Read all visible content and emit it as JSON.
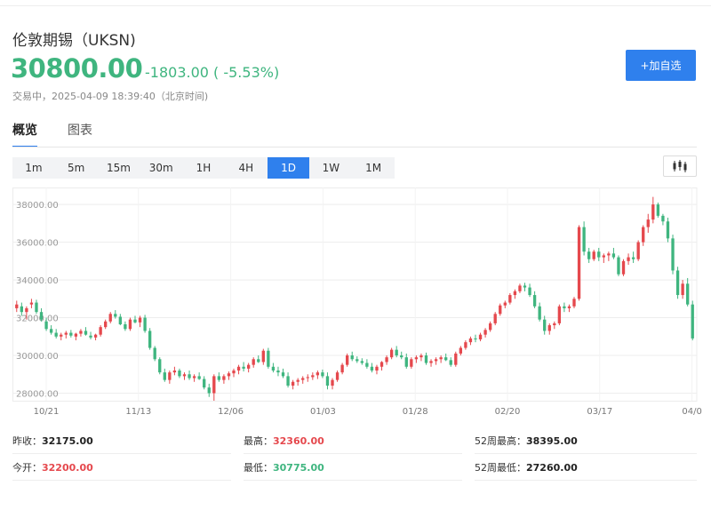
{
  "header": {
    "title": "伦敦期锡（UKSN)",
    "price": "30800.00",
    "change": "-1803.00 ( -5.53%)",
    "status": "交易中，2025-04-09 18:39:40（北京时间)",
    "add_button": "+加自选"
  },
  "tabs": [
    {
      "label": "概览",
      "active": true
    },
    {
      "label": "图表",
      "active": false
    }
  ],
  "periods": [
    {
      "label": "1m",
      "active": false
    },
    {
      "label": "5m",
      "active": false
    },
    {
      "label": "15m",
      "active": false
    },
    {
      "label": "30m",
      "active": false
    },
    {
      "label": "1H",
      "active": false
    },
    {
      "label": "4H",
      "active": false
    },
    {
      "label": "1D",
      "active": true
    },
    {
      "label": "1W",
      "active": false
    },
    {
      "label": "1M",
      "active": false
    }
  ],
  "chart_type_icon": "candlestick-icon",
  "colors": {
    "up": "#e5484d",
    "down": "#3fb57f",
    "accent": "#2f80ed"
  },
  "chart_data": {
    "type": "candlestick",
    "y_ticks": [
      "38000.00",
      "36000.00",
      "34000.00",
      "32000.00",
      "30000.00",
      "28000.00"
    ],
    "x_ticks": [
      "10/21",
      "11/13",
      "12/06",
      "01/03",
      "01/28",
      "02/20",
      "03/17",
      "04/0"
    ],
    "ylim": [
      27600,
      38900
    ],
    "grid": true,
    "candles": [
      [
        32500,
        32900,
        32300,
        32700
      ],
      [
        32600,
        32800,
        32100,
        32300
      ],
      [
        32300,
        32600,
        31900,
        32500
      ],
      [
        32700,
        33000,
        32500,
        32800
      ],
      [
        32800,
        32950,
        32200,
        32300
      ],
      [
        32300,
        32500,
        31800,
        31900
      ],
      [
        31800,
        32000,
        31300,
        31400
      ],
      [
        31400,
        31600,
        31100,
        31200
      ],
      [
        31200,
        31400,
        30900,
        31000
      ],
      [
        31000,
        31200,
        30800,
        31100
      ],
      [
        31100,
        31300,
        30900,
        31200
      ],
      [
        31200,
        31350,
        30950,
        31050
      ],
      [
        31000,
        31200,
        30800,
        31150
      ],
      [
        31150,
        31400,
        31000,
        31300
      ],
      [
        31300,
        31500,
        31050,
        31100
      ],
      [
        31050,
        31250,
        30850,
        30950
      ],
      [
        30950,
        31150,
        30800,
        31100
      ],
      [
        31100,
        31600,
        31000,
        31500
      ],
      [
        31500,
        31900,
        31400,
        31800
      ],
      [
        31800,
        32300,
        31700,
        32200
      ],
      [
        32200,
        32400,
        31950,
        32050
      ],
      [
        32050,
        32200,
        31600,
        31650
      ],
      [
        31650,
        31800,
        31300,
        31400
      ],
      [
        31400,
        32000,
        31300,
        31900
      ],
      [
        31900,
        32100,
        31700,
        31750
      ],
      [
        31750,
        32100,
        31500,
        32000
      ],
      [
        32000,
        32150,
        31200,
        31300
      ],
      [
        31300,
        31450,
        30300,
        30400
      ],
      [
        30400,
        30500,
        29700,
        29800
      ],
      [
        29800,
        29900,
        29000,
        29100
      ],
      [
        29100,
        29300,
        28600,
        28700
      ],
      [
        28700,
        29200,
        28500,
        29100
      ],
      [
        29100,
        29400,
        28950,
        29200
      ],
      [
        29200,
        29300,
        28800,
        28900
      ],
      [
        28900,
        29100,
        28700,
        29000
      ],
      [
        29000,
        29200,
        28700,
        28800
      ],
      [
        28800,
        29000,
        28600,
        28900
      ],
      [
        28900,
        29100,
        28700,
        28750
      ],
      [
        28750,
        28900,
        28200,
        28300
      ],
      [
        28300,
        28500,
        27800,
        28000
      ],
      [
        28000,
        29000,
        27600,
        28900
      ],
      [
        28900,
        29100,
        28600,
        28700
      ],
      [
        28700,
        29000,
        28500,
        28900
      ],
      [
        28900,
        29150,
        28700,
        29050
      ],
      [
        29050,
        29300,
        28850,
        29200
      ],
      [
        29200,
        29500,
        29000,
        29400
      ],
      [
        29400,
        29650,
        29150,
        29300
      ],
      [
        29300,
        29600,
        29100,
        29500
      ],
      [
        29500,
        29900,
        29350,
        29800
      ],
      [
        29800,
        30000,
        29600,
        29650
      ],
      [
        29650,
        30350,
        29500,
        30250
      ],
      [
        30250,
        30400,
        29300,
        29400
      ],
      [
        29400,
        29600,
        29100,
        29200
      ],
      [
        29200,
        29400,
        28900,
        29100
      ],
      [
        29100,
        29300,
        28800,
        28900
      ],
      [
        28900,
        29100,
        28300,
        28400
      ],
      [
        28400,
        28700,
        28200,
        28600
      ],
      [
        28600,
        28800,
        28400,
        28700
      ],
      [
        28700,
        28900,
        28500,
        28800
      ],
      [
        28800,
        29000,
        28600,
        28850
      ],
      [
        28850,
        29100,
        28700,
        28950
      ],
      [
        28950,
        29200,
        28750,
        29100
      ],
      [
        29100,
        29250,
        28800,
        28900
      ],
      [
        28900,
        29100,
        28200,
        28400
      ],
      [
        28400,
        28800,
        28200,
        28700
      ],
      [
        28700,
        29200,
        28600,
        29100
      ],
      [
        29100,
        29600,
        29000,
        29500
      ],
      [
        29500,
        30100,
        29400,
        30000
      ],
      [
        30000,
        30200,
        29700,
        29800
      ],
      [
        29800,
        29950,
        29600,
        29700
      ],
      [
        29700,
        29850,
        29500,
        29600
      ],
      [
        29600,
        29800,
        29300,
        29400
      ],
      [
        29400,
        29600,
        29100,
        29200
      ],
      [
        29200,
        29500,
        29000,
        29400
      ],
      [
        29400,
        29700,
        29200,
        29650
      ],
      [
        29650,
        30000,
        29500,
        29900
      ],
      [
        29900,
        30400,
        29800,
        30300
      ],
      [
        30300,
        30500,
        29900,
        30000
      ],
      [
        30000,
        30200,
        29800,
        29900
      ],
      [
        29900,
        30100,
        29300,
        29400
      ],
      [
        29400,
        29900,
        29300,
        29800
      ],
      [
        29800,
        30000,
        29600,
        29900
      ],
      [
        29900,
        30100,
        29700,
        30000
      ],
      [
        30000,
        30150,
        29500,
        29600
      ],
      [
        29600,
        29800,
        29400,
        29700
      ],
      [
        29700,
        29900,
        29500,
        29800
      ],
      [
        29800,
        30000,
        29600,
        29900
      ],
      [
        29900,
        30100,
        29700,
        29750
      ],
      [
        29750,
        29900,
        29400,
        29500
      ],
      [
        29500,
        30200,
        29400,
        30100
      ],
      [
        30100,
        30500,
        30000,
        30400
      ],
      [
        30400,
        30800,
        30300,
        30700
      ],
      [
        30700,
        31000,
        30550,
        30900
      ],
      [
        30900,
        31100,
        30700,
        30850
      ],
      [
        30850,
        31200,
        30750,
        31100
      ],
      [
        31100,
        31450,
        30950,
        31350
      ],
      [
        31350,
        31800,
        31250,
        31700
      ],
      [
        31700,
        32300,
        31600,
        32200
      ],
      [
        32200,
        32750,
        32100,
        32650
      ],
      [
        32650,
        32900,
        32500,
        32800
      ],
      [
        32800,
        33300,
        32700,
        33200
      ],
      [
        33200,
        33500,
        33000,
        33400
      ],
      [
        33400,
        33800,
        33300,
        33700
      ],
      [
        33700,
        33850,
        33400,
        33600
      ],
      [
        33600,
        33800,
        33100,
        33200
      ],
      [
        33200,
        33400,
        32500,
        32600
      ],
      [
        32600,
        32800,
        31800,
        31900
      ],
      [
        31900,
        32100,
        31100,
        31300
      ],
      [
        31300,
        31700,
        31100,
        31600
      ],
      [
        31600,
        31800,
        31400,
        31700
      ],
      [
        31700,
        32700,
        31600,
        32600
      ],
      [
        32600,
        32800,
        32300,
        32500
      ],
      [
        32500,
        32700,
        32300,
        32600
      ],
      [
        32600,
        33100,
        32500,
        33000
      ],
      [
        33000,
        36900,
        32900,
        36800
      ],
      [
        36800,
        37100,
        35300,
        35500
      ],
      [
        35500,
        35700,
        34900,
        35100
      ],
      [
        35100,
        35600,
        35000,
        35500
      ],
      [
        35500,
        35700,
        35000,
        35200
      ],
      [
        35200,
        35400,
        34900,
        35300
      ],
      [
        35300,
        35500,
        35000,
        35400
      ],
      [
        35400,
        35700,
        35100,
        35200
      ],
      [
        35200,
        35300,
        34200,
        34300
      ],
      [
        34300,
        35100,
        34200,
        35000
      ],
      [
        35000,
        35400,
        34800,
        35200
      ],
      [
        35200,
        35500,
        34900,
        35100
      ],
      [
        35100,
        36100,
        35000,
        36000
      ],
      [
        36000,
        36900,
        35800,
        36800
      ],
      [
        36800,
        37500,
        36500,
        37200
      ],
      [
        37200,
        38400,
        37000,
        38000
      ],
      [
        38000,
        38100,
        37300,
        37400
      ],
      [
        37400,
        37500,
        36900,
        37100
      ],
      [
        37100,
        37300,
        36000,
        36200
      ],
      [
        36200,
        36400,
        34300,
        34500
      ],
      [
        34500,
        34700,
        33000,
        33200
      ],
      [
        33200,
        34000,
        33000,
        33800
      ],
      [
        33800,
        34100,
        32600,
        32700
      ],
      [
        32700,
        32900,
        30800,
        30900
      ]
    ]
  },
  "stats": {
    "prev_close_label": "昨收：",
    "prev_close": "32175.00",
    "high_label": "最高：",
    "high": "32360.00",
    "w52_high_label": "52周最高：",
    "w52_high": "38395.00",
    "open_label": "今开：",
    "open": "32200.00",
    "low_label": "最低：",
    "low": "30775.00",
    "w52_low_label": "52周最低：",
    "w52_low": "27260.00"
  }
}
